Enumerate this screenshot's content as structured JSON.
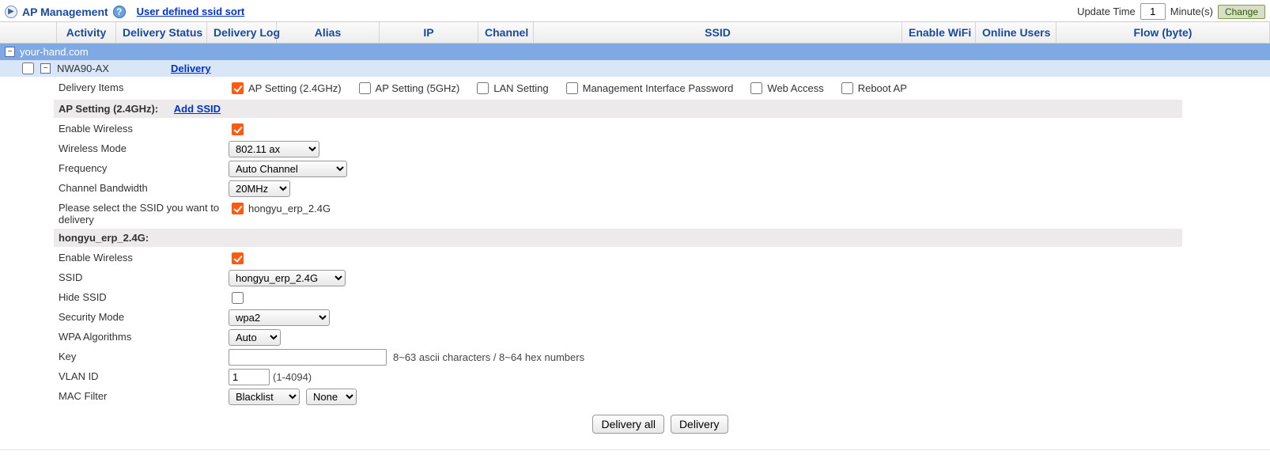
{
  "header": {
    "title": "AP Management",
    "ssid_sort": "User defined ssid sort",
    "update_time_label": "Update Time",
    "update_time_value": "1",
    "minutes_label": "Minute(s)",
    "change_label": "Change"
  },
  "columns": {
    "activity": "Activity",
    "delivery_status": "Delivery Status",
    "delivery_log": "Delivery Log",
    "alias": "Alias",
    "ip": "IP",
    "channel": "Channel",
    "ssid": "SSID",
    "enable_wifi": "Enable WiFi",
    "online_users": "Online Users",
    "flow": "Flow (byte)"
  },
  "group": {
    "domain": "your-hand.com",
    "device": "NWA90-AX",
    "delivery_link": "Delivery"
  },
  "delivery_items": {
    "label": "Delivery Items",
    "items": [
      {
        "label": "AP Setting (2.4GHz)",
        "checked": true
      },
      {
        "label": "AP Setting (5GHz)",
        "checked": false
      },
      {
        "label": "LAN Setting",
        "checked": false
      },
      {
        "label": "Management Interface Password",
        "checked": false
      },
      {
        "label": "Web Access",
        "checked": false
      },
      {
        "label": "Reboot AP",
        "checked": false
      }
    ]
  },
  "section2g": {
    "title": "AP Setting (2.4GHz):",
    "add_ssid": "Add SSID",
    "fields": {
      "enable_wireless_label": "Enable Wireless",
      "wireless_mode_label": "Wireless Mode",
      "wireless_mode_value": "802.11 ax",
      "frequency_label": "Frequency",
      "frequency_value": "Auto Channel",
      "bandwidth_label": "Channel Bandwidth",
      "bandwidth_value": "20MHz",
      "ssid_select_label": "Please select the SSID you want to delivery",
      "ssid_select_value": "hongyu_erp_2.4G"
    }
  },
  "ssid_section": {
    "title": "hongyu_erp_2.4G:",
    "enable_wireless_label": "Enable Wireless",
    "ssid_label": "SSID",
    "ssid_value": "hongyu_erp_2.4G",
    "hide_ssid_label": "Hide SSID",
    "security_mode_label": "Security Mode",
    "security_mode_value": "wpa2",
    "wpa_algo_label": "WPA Algorithms",
    "wpa_algo_value": "Auto",
    "key_label": "Key",
    "key_value": "",
    "key_hint": "8~63 ascii characters / 8~64 hex numbers",
    "vlan_label": "VLAN ID",
    "vlan_value": "1",
    "vlan_hint": "(1-4094)",
    "mac_filter_label": "MAC Filter",
    "mac_filter_mode": "Blacklist",
    "mac_filter_list": "None"
  },
  "actions": {
    "delivery_all": "Delivery all",
    "delivery": "Delivery"
  }
}
